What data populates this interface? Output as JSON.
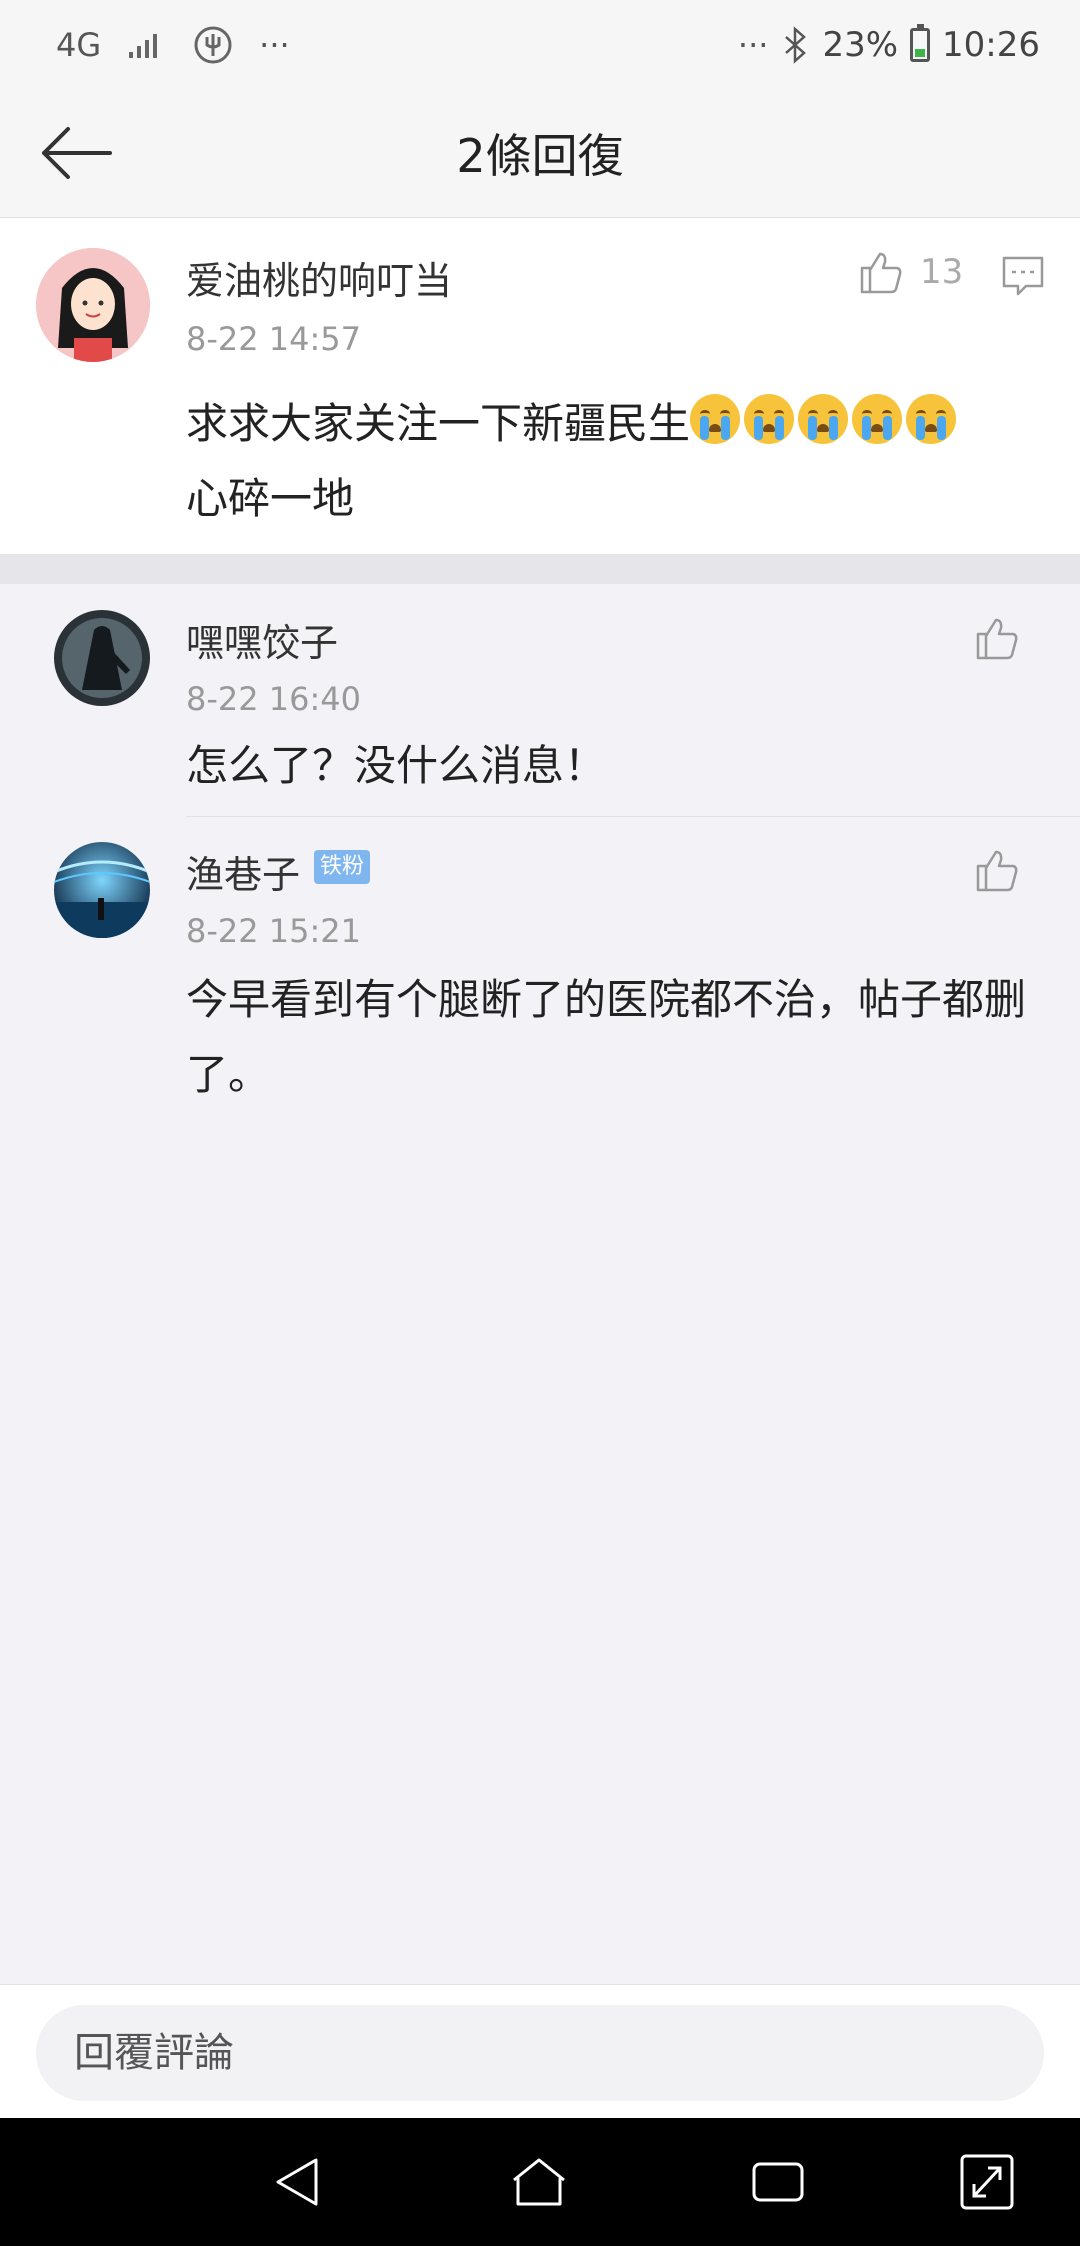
{
  "status_bar": {
    "network": "4G",
    "more_left": "···",
    "more_right": "···",
    "battery": "23%",
    "time": "10:26"
  },
  "header": {
    "title": "2條回復"
  },
  "main_comment": {
    "author": "爱油桃的响叮当",
    "time": "8-22 14:57",
    "likes": "13",
    "text_line1": "求求大家关注一下新疆民生",
    "emoji": "crying-face-emoji",
    "emoji_count": 5,
    "text_line2": "心碎一地"
  },
  "replies": [
    {
      "author": "嘿嘿饺子",
      "time": "8-22 16:40",
      "text": "怎么了？没什么消息！"
    },
    {
      "author": "渔巷子",
      "badge": "铁粉",
      "time": "8-22 15:21",
      "text_line1": "今早看到有个腿断了的医院都不治，帖子都删",
      "text_line2": "了。"
    }
  ],
  "bottom_bar": {
    "reply_placeholder": "回覆評論"
  },
  "icons": {
    "back": "arrow-left-icon",
    "like": "thumbs-up-icon",
    "reply": "comment-icon",
    "nav_back": "triangle-back-icon",
    "nav_home": "home-icon",
    "nav_recent": "recent-apps-icon",
    "nav_expand": "expand-icon"
  }
}
